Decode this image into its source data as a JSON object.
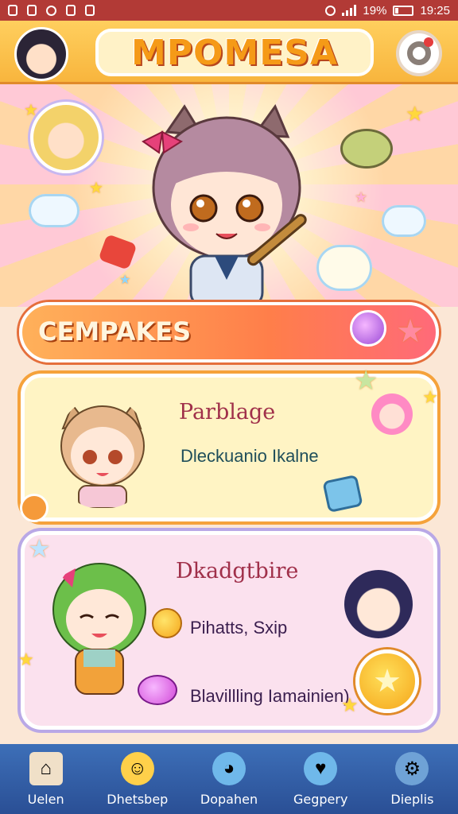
{
  "status_bar": {
    "battery": "19%",
    "time": "19:25"
  },
  "header": {
    "app_title": "MPOMESA"
  },
  "section": {
    "title": "CEMPAKES"
  },
  "cards": [
    {
      "title": "Parblage",
      "subtitle": "Dleckuanio Ikalne"
    },
    {
      "title": "Dkadgtbire",
      "line1": "Pihatts, Sxip",
      "line2": "Blavillling Iamainien)"
    }
  ],
  "bottom_nav": [
    {
      "label": "Uelen",
      "icon": "home-icon"
    },
    {
      "label": "Dhetsbep",
      "icon": "smiley-icon"
    },
    {
      "label": "Dopahen",
      "icon": "cat-face-icon"
    },
    {
      "label": "Gegpery",
      "icon": "heart-chat-icon"
    },
    {
      "label": "Dieplis",
      "icon": "gear-icon"
    }
  ]
}
